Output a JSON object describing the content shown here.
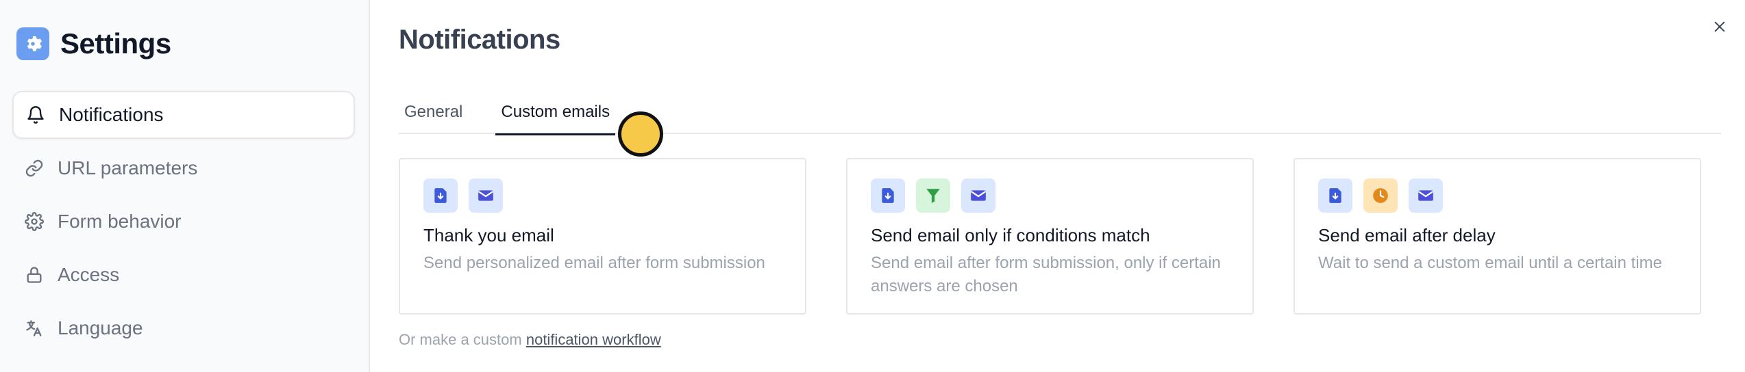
{
  "sidebar": {
    "title": "Settings",
    "items": [
      {
        "label": "Notifications",
        "icon": "bell-icon",
        "active": true
      },
      {
        "label": "URL parameters",
        "icon": "link-icon",
        "active": false
      },
      {
        "label": "Form behavior",
        "icon": "gear-icon",
        "active": false
      },
      {
        "label": "Access",
        "icon": "lock-icon",
        "active": false
      },
      {
        "label": "Language",
        "icon": "translate-icon",
        "active": false
      }
    ]
  },
  "main": {
    "title": "Notifications",
    "tabs": [
      {
        "label": "General",
        "active": false
      },
      {
        "label": "Custom emails",
        "active": true
      }
    ],
    "cards": [
      {
        "title": "Thank you email",
        "description": "Send personalized email after form submission",
        "icons": [
          "form-submit-icon",
          "envelope-icon"
        ]
      },
      {
        "title": "Send email only if conditions match",
        "description": "Send email after form submission, only if certain answers are chosen",
        "icons": [
          "form-submit-icon",
          "filter-icon",
          "envelope-icon"
        ]
      },
      {
        "title": "Send email after delay",
        "description": "Wait to send a custom email until a certain time",
        "icons": [
          "form-submit-icon",
          "clock-icon",
          "envelope-icon"
        ]
      }
    ],
    "footer": {
      "prefix": "Or make a custom",
      "link": "notification workflow"
    }
  },
  "colors": {
    "brand": "#6b9ef0",
    "cursor": "#f7c948",
    "icon_blue": "#3b5bdb",
    "icon_green": "#2f9e44",
    "icon_orange": "#e08a1e"
  }
}
